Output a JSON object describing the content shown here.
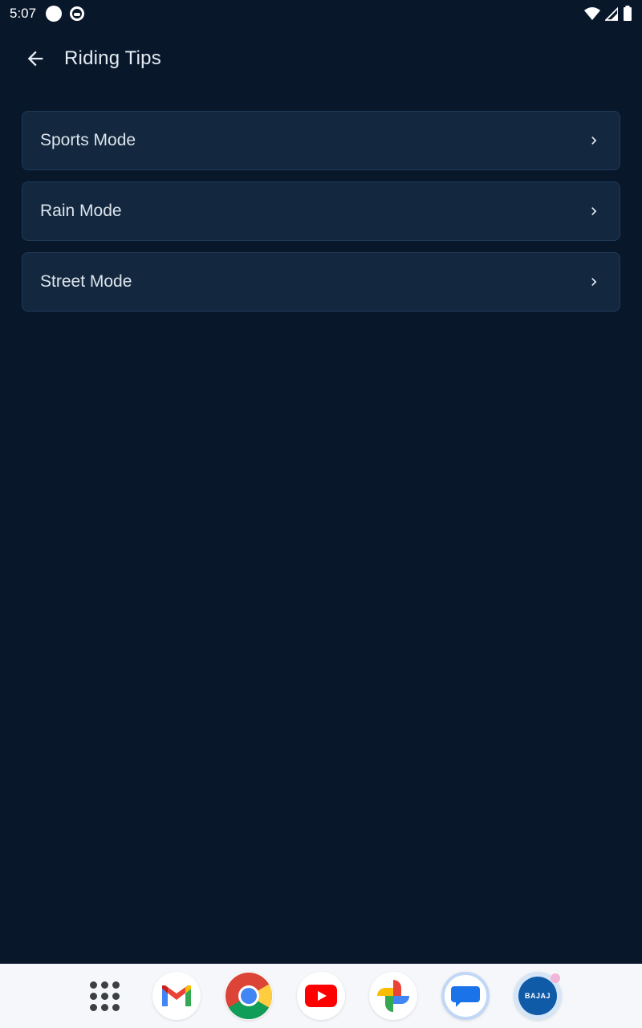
{
  "status_bar": {
    "time": "5:07"
  },
  "header": {
    "title": "Riding Tips"
  },
  "tips": [
    {
      "label": "Sports Mode"
    },
    {
      "label": "Rain Mode"
    },
    {
      "label": "Street Mode"
    }
  ],
  "dock": {
    "apps": [
      {
        "icon": "app-drawer-icon"
      },
      {
        "icon": "gmail-icon"
      },
      {
        "icon": "chrome-icon"
      },
      {
        "icon": "youtube-icon"
      },
      {
        "icon": "photos-icon"
      },
      {
        "icon": "messages-icon"
      },
      {
        "icon": "bajaj-ride-connect-icon",
        "logo_text": "BAJAJ"
      }
    ]
  },
  "colors": {
    "background": "#08172a",
    "card": "#13283f",
    "card_border": "#1f3a58",
    "text": "#dde4ec",
    "dock": "#f6f7fb"
  }
}
